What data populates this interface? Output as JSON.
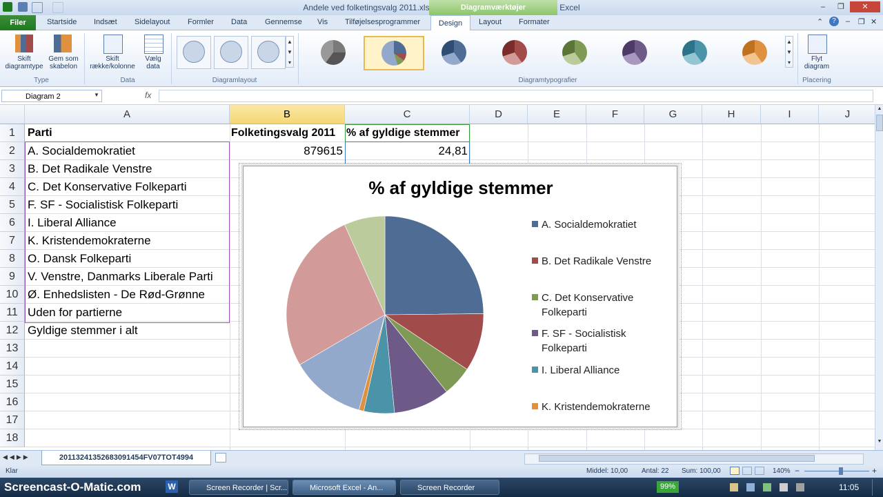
{
  "window": {
    "title": "Andele ved folketingsvalg 2011.xls  [Kompatibilitetstilstand]  -  Microsoft Excel",
    "context_tab": "Diagramværktøjer"
  },
  "tabs": {
    "file": "Filer",
    "items": [
      "Startside",
      "Indsæt",
      "Sidelayout",
      "Formler",
      "Data",
      "Gennemse",
      "Vis",
      "Tilføjelsesprogrammer",
      "Design",
      "Layout",
      "Formater"
    ]
  },
  "ribbon": {
    "change_type": "Skift diagramtype",
    "save_template": "Gem som skabelon",
    "switch_row_col": "Skift række/kolonne",
    "select_data": "Vælg data",
    "move_chart": "Flyt diagram",
    "groups": {
      "type": "Type",
      "data": "Data",
      "layout": "Diagramlayout",
      "styles": "Diagramtypografier",
      "location": "Placering"
    }
  },
  "formula_bar": {
    "name_box": "Diagram 2",
    "fx": "fx",
    "content": ""
  },
  "columns": [
    "A",
    "B",
    "C",
    "D",
    "E",
    "F",
    "G",
    "H",
    "I",
    "J"
  ],
  "rows": [
    "1",
    "2",
    "3",
    "4",
    "5",
    "6",
    "7",
    "8",
    "9",
    "10",
    "11",
    "12",
    "13",
    "14",
    "15",
    "16",
    "17",
    "18"
  ],
  "cells": {
    "A1": "Parti",
    "B1": "Folketingsvalg 2011",
    "C1": "% af gyldige stemmer",
    "B2": "879615",
    "C2": "24,81",
    "A": [
      "A. Socialdemokratiet",
      "B. Det Radikale Venstre",
      "C. Det Konservative Folkeparti",
      "F. SF - Socialistisk Folkeparti",
      "I. Liberal Alliance",
      "K. Kristendemokraterne",
      "O. Dansk Folkeparti",
      "V. Venstre, Danmarks Liberale Parti",
      "Ø. Enhedslisten - De Rød-Grønne",
      "Uden for partierne",
      "Gyldige stemmer i alt"
    ]
  },
  "chart_data": {
    "type": "pie",
    "title": "% af gyldige stemmer",
    "categories": [
      "A. Socialdemokratiet",
      "B. Det Radikale Venstre",
      "C. Det Konservative Folkeparti",
      "F. SF - Socialistisk Folkeparti",
      "I. Liberal Alliance",
      "K. Kristendemokraterne",
      "O. Dansk Folkeparti",
      "V. Venstre, Danmarks Liberale Parti",
      "Ø. Enhedslisten - De Rød-Grønne"
    ],
    "values": [
      24.8,
      9.5,
      4.9,
      9.2,
      5.0,
      0.8,
      12.3,
      26.7,
      6.7
    ],
    "colors": [
      "#4f6d94",
      "#a24b4b",
      "#7f9a55",
      "#6d5a88",
      "#4a93a8",
      "#e0913f",
      "#93a9cc",
      "#d39a9a",
      "#bccb9c"
    ],
    "legend": "right"
  },
  "sheet_tab": "20113241352683091454FV07TOT4994",
  "status": {
    "ready": "Klar",
    "average": "Middel: 10,00",
    "count": "Antal: 22",
    "sum": "Sum: 100,00",
    "zoom": "140%"
  },
  "taskbar": {
    "recorder_watermark": "Screencast-O-Matic.com",
    "items": [
      "Screen Recorder | Scr...",
      "Microsoft Excel - An...",
      "Screen Recorder"
    ],
    "battery": "99%",
    "clock": "11:05"
  }
}
